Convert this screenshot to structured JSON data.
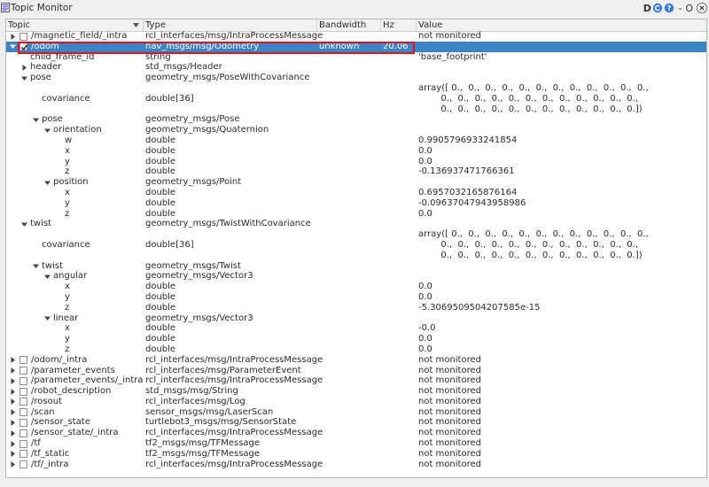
{
  "window": {
    "title": "Topic Monitor",
    "buttons": {
      "d": "D",
      "dash": "-",
      "o": "O"
    }
  },
  "columns": {
    "topic": "Topic",
    "type": "Type",
    "bandwidth": "Bandwidth",
    "hz": "Hz",
    "value": "Value"
  },
  "rows": [
    {
      "topic": "/magnetic_field/_intra",
      "type": "rcl_interfaces/msg/IntraProcessMessage",
      "value": "not monitored"
    },
    {
      "topic": "/odom",
      "type": "nav_msgs/msg/Odometry",
      "bandwidth": "unknown",
      "hz": "20.06",
      "value": ""
    },
    {
      "topic": "child_frame_id",
      "type": "string",
      "value": "'base_footprint'"
    },
    {
      "topic": "header",
      "type": "std_msgs/Header",
      "value": ""
    },
    {
      "topic": "pose",
      "type": "geometry_msgs/PoseWithCovariance",
      "value": ""
    },
    {
      "topic": "covariance",
      "type": "double[36]",
      "value_lines": [
        "array([ 0.,  0.,  0.,  0.,  0.,  0.,  0.,  0.,  0.,  0.,  0.,  0.,",
        "        0.,  0.,  0.,  0.,  0.,  0.,  0.,  0.,  0.,  0.,  0.,  0.,",
        "        0.,  0.,  0.,  0.,  0.,  0.,  0.,  0.,  0.,  0.,  0.,  0.])"
      ]
    },
    {
      "topic": "pose",
      "type": "geometry_msgs/Pose",
      "value": ""
    },
    {
      "topic": "orientation",
      "type": "geometry_msgs/Quaternion",
      "value": ""
    },
    {
      "topic": "w",
      "type": "double",
      "value": "0.9905796933241854"
    },
    {
      "topic": "x",
      "type": "double",
      "value": "0.0"
    },
    {
      "topic": "y",
      "type": "double",
      "value": "0.0"
    },
    {
      "topic": "z",
      "type": "double",
      "value": "-0.136937471766361"
    },
    {
      "topic": "position",
      "type": "geometry_msgs/Point",
      "value": ""
    },
    {
      "topic": "x",
      "type": "double",
      "value": "0.6957032165876164"
    },
    {
      "topic": "y",
      "type": "double",
      "value": "-0.09637047943958986"
    },
    {
      "topic": "z",
      "type": "double",
      "value": "0.0"
    },
    {
      "topic": "twist",
      "type": "geometry_msgs/TwistWithCovariance",
      "value": ""
    },
    {
      "topic": "covariance",
      "type": "double[36]",
      "value_lines": [
        "array([ 0.,  0.,  0.,  0.,  0.,  0.,  0.,  0.,  0.,  0.,  0.,  0.,",
        "        0.,  0.,  0.,  0.,  0.,  0.,  0.,  0.,  0.,  0.,  0.,  0.,",
        "        0.,  0.,  0.,  0.,  0.,  0.,  0.,  0.,  0.,  0.,  0.,  0.])"
      ]
    },
    {
      "topic": "twist",
      "type": "geometry_msgs/Twist",
      "value": ""
    },
    {
      "topic": "angular",
      "type": "geometry_msgs/Vector3",
      "value": ""
    },
    {
      "topic": "x",
      "type": "double",
      "value": "0.0"
    },
    {
      "topic": "y",
      "type": "double",
      "value": "0.0"
    },
    {
      "topic": "z",
      "type": "double",
      "value": "-5.3069509504207585e-15"
    },
    {
      "topic": "linear",
      "type": "geometry_msgs/Vector3",
      "value": ""
    },
    {
      "topic": "x",
      "type": "double",
      "value": "-0.0"
    },
    {
      "topic": "y",
      "type": "double",
      "value": "0.0"
    },
    {
      "topic": "z",
      "type": "double",
      "value": "0.0"
    },
    {
      "topic": "/odom/_intra",
      "type": "rcl_interfaces/msg/IntraProcessMessage",
      "value": "not monitored"
    },
    {
      "topic": "/parameter_events",
      "type": "rcl_interfaces/msg/ParameterEvent",
      "value": "not monitored"
    },
    {
      "topic": "/parameter_events/_intra",
      "type": "rcl_interfaces/msg/IntraProcessMessage",
      "value": "not monitored"
    },
    {
      "topic": "/robot_description",
      "type": "std_msgs/msg/String",
      "value": "not monitored"
    },
    {
      "topic": "/rosout",
      "type": "rcl_interfaces/msg/Log",
      "value": "not monitored"
    },
    {
      "topic": "/scan",
      "type": "sensor_msgs/msg/LaserScan",
      "value": "not monitored"
    },
    {
      "topic": "/sensor_state",
      "type": "turtlebot3_msgs/msg/SensorState",
      "value": "not monitored"
    },
    {
      "topic": "/sensor_state/_intra",
      "type": "rcl_interfaces/msg/IntraProcessMessage",
      "value": "not monitored"
    },
    {
      "topic": "/tf",
      "type": "tf2_msgs/msg/TFMessage",
      "value": "not monitored"
    },
    {
      "topic": "/tf_static",
      "type": "tf2_msgs/msg/TFMessage",
      "value": "not monitored"
    },
    {
      "topic": "/tf/_intra",
      "type": "rcl_interfaces/msg/IntraProcessMessage",
      "value": "not monitored"
    }
  ],
  "colors": {
    "selection": "#3b84c5",
    "highlight_border": "#e0141e"
  }
}
